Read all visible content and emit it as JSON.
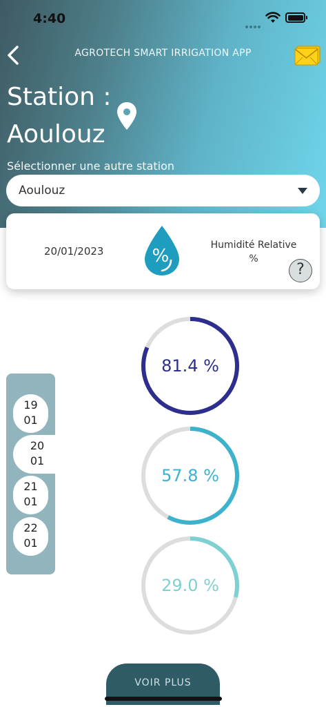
{
  "status_bar": {
    "time": "4:40"
  },
  "header": {
    "app_title": "AGROTECH SMART IRRIGATION APP"
  },
  "station": {
    "title": "Station :",
    "name": "Aoulouz"
  },
  "selector": {
    "label": "Sélectionner une autre station",
    "value": "Aoulouz"
  },
  "card": {
    "date": "20/01/2023",
    "metric_label": "Humidité Relative",
    "metric_unit": "%",
    "help": "?",
    "drop_symbol": "%"
  },
  "dates": [
    {
      "day": "19",
      "month": "01"
    },
    {
      "day": "20",
      "month": "01"
    },
    {
      "day": "21",
      "month": "01"
    },
    {
      "day": "22",
      "month": "01"
    }
  ],
  "readings": [
    {
      "label": "81.4 %",
      "value": 81.4,
      "color": "#2e2e8e"
    },
    {
      "label": "57.8 %",
      "value": 57.8,
      "color": "#3cb2cc"
    },
    {
      "label": "29.0 %",
      "value": 29.0,
      "color": "#7fd0d2"
    }
  ],
  "more_button": {
    "label": "VOIR PLUS"
  },
  "colors": {
    "track": "#dddddd",
    "rail": "#92b4bc",
    "button": "#2f5b66"
  }
}
